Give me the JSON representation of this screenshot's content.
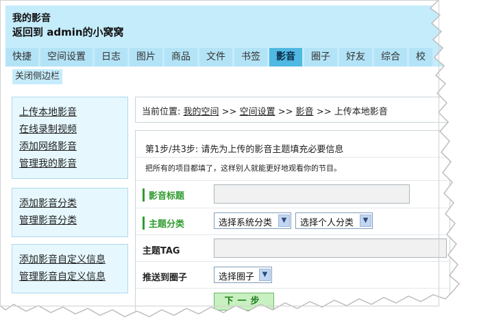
{
  "header": {
    "title": "我的影音",
    "back_link": "返回到 admin的小窝窝"
  },
  "tabs": [
    {
      "label": "快捷"
    },
    {
      "label": "空间设置"
    },
    {
      "label": "日志"
    },
    {
      "label": "图片"
    },
    {
      "label": "商品"
    },
    {
      "label": "文件"
    },
    {
      "label": "书签"
    },
    {
      "label": "影音",
      "active": true
    },
    {
      "label": "圈子"
    },
    {
      "label": "好友"
    },
    {
      "label": "综合"
    },
    {
      "label": "校"
    }
  ],
  "close_sidebar": "关闭侧边栏",
  "sidebar": {
    "group1": [
      "上传本地影音",
      "在线录制视频",
      "添加网络影音",
      "管理我的影音"
    ],
    "group2": [
      "添加影音分类",
      "管理影音分类"
    ],
    "group3": [
      "添加影音自定义信息",
      "管理影音自定义信息"
    ]
  },
  "breadcrumb": {
    "prefix": "当前位置: ",
    "items": [
      "我的空间",
      "空间设置",
      "影音"
    ],
    "sep": " >> ",
    "current": "上传本地影音"
  },
  "form": {
    "step": "第1步/共3步: 请先为上传的影音主题填充必要信息",
    "hint": "把所有的项目都填了，这样别人就能更好地观看你的节目。",
    "title_label": "影音标题",
    "category_label": "主题分类",
    "system_category": "选择系统分类",
    "personal_category": "选择个人分类",
    "tag_label": "主题TAG",
    "circle_label": "推送到圈子",
    "circle_select": "选择圈子",
    "next_button": "下一步"
  }
}
